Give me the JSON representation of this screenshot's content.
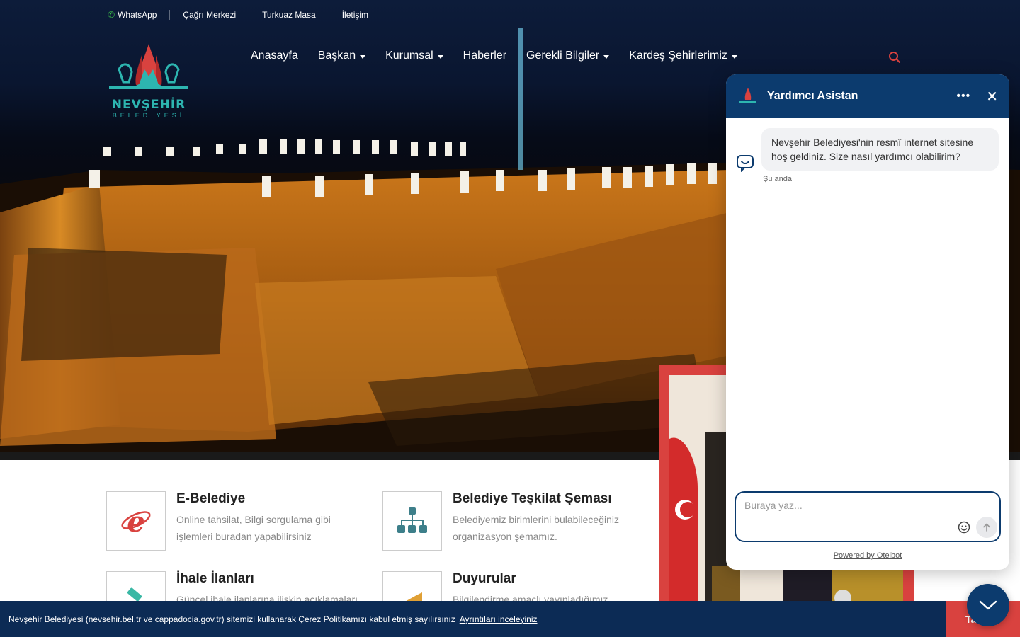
{
  "topbar": {
    "whatsapp": "WhatsApp",
    "call_center": "Çağrı Merkezi",
    "turkuaz": "Turkuaz Masa",
    "contact": "İletişim"
  },
  "logo": {
    "name": "NEVŞEHİR",
    "sub": "BELEDİYESİ"
  },
  "nav": {
    "home": "Anasayfa",
    "mayor": "Başkan",
    "corporate": "Kurumsal",
    "news": "Haberler",
    "info": "Gerekli Bilgiler",
    "sister_cities": "Kardeş Şehirlerimiz"
  },
  "links": {
    "ebelediye": {
      "title": "E-Belediye",
      "desc": "Online tahsilat, Bilgi sorgulama gibi işlemleri buradan yapabilirsiniz"
    },
    "teskilat": {
      "title": "Belediye Teşkilat Şeması",
      "desc": "Belediyemiz birimlerini bulabileceğiniz organizasyon şemamız."
    },
    "ihale": {
      "title": "İhale İlanları",
      "desc": "Güncel ihale ilanlarına ilişkin açıklamaları"
    },
    "duyurular": {
      "title": "Duyurular",
      "desc": "Bilgilendirme amaçlı yayınladığımız"
    }
  },
  "chat": {
    "title": "Yardımcı Asistan",
    "more": "•••",
    "close": "✕",
    "message": "Nevşehir Belediyesi'nin resmî internet sitesine hoş geldiniz. Size nasıl yardımcı olabilirim?",
    "time": "Şu anda",
    "placeholder": "Buraya yaz...",
    "powered": "Powered by Otelbot"
  },
  "cookie": {
    "text": "Nevşehir Belediyesi (nevsehir.bel.tr ve cappadocia.gov.tr) sitemizi kullanarak Çerez Politikamızı kabul etmiş sayılırsınız",
    "link": "Ayrıntıları inceleyiniz",
    "button": "Ta"
  },
  "colors": {
    "accent": "#d9423f",
    "primary": "#0c3b6e",
    "teal": "#2db5b0"
  }
}
